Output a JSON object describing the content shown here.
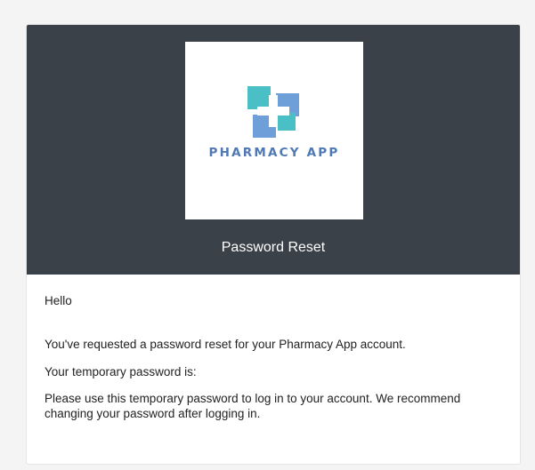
{
  "email": {
    "logo": {
      "brand_text": "PHARMACY APP",
      "icon": "medical-cross-logo-icon"
    },
    "header_title": "Password Reset",
    "body": {
      "greeting": "Hello",
      "requested_text": "You've requested a password reset for your Pharmacy App account.",
      "temp_password_text": "Your temporary password is:",
      "instructions_text": "Please use this temporary password to log in to your account. We recommend changing your password after logging in."
    }
  },
  "colors": {
    "page_background": "#f4f4f4",
    "header_background": "#3a4149",
    "logo_teal": "#4bbfc6",
    "logo_blue": "#6f9fd8",
    "brand_text": "#4f78b4"
  }
}
